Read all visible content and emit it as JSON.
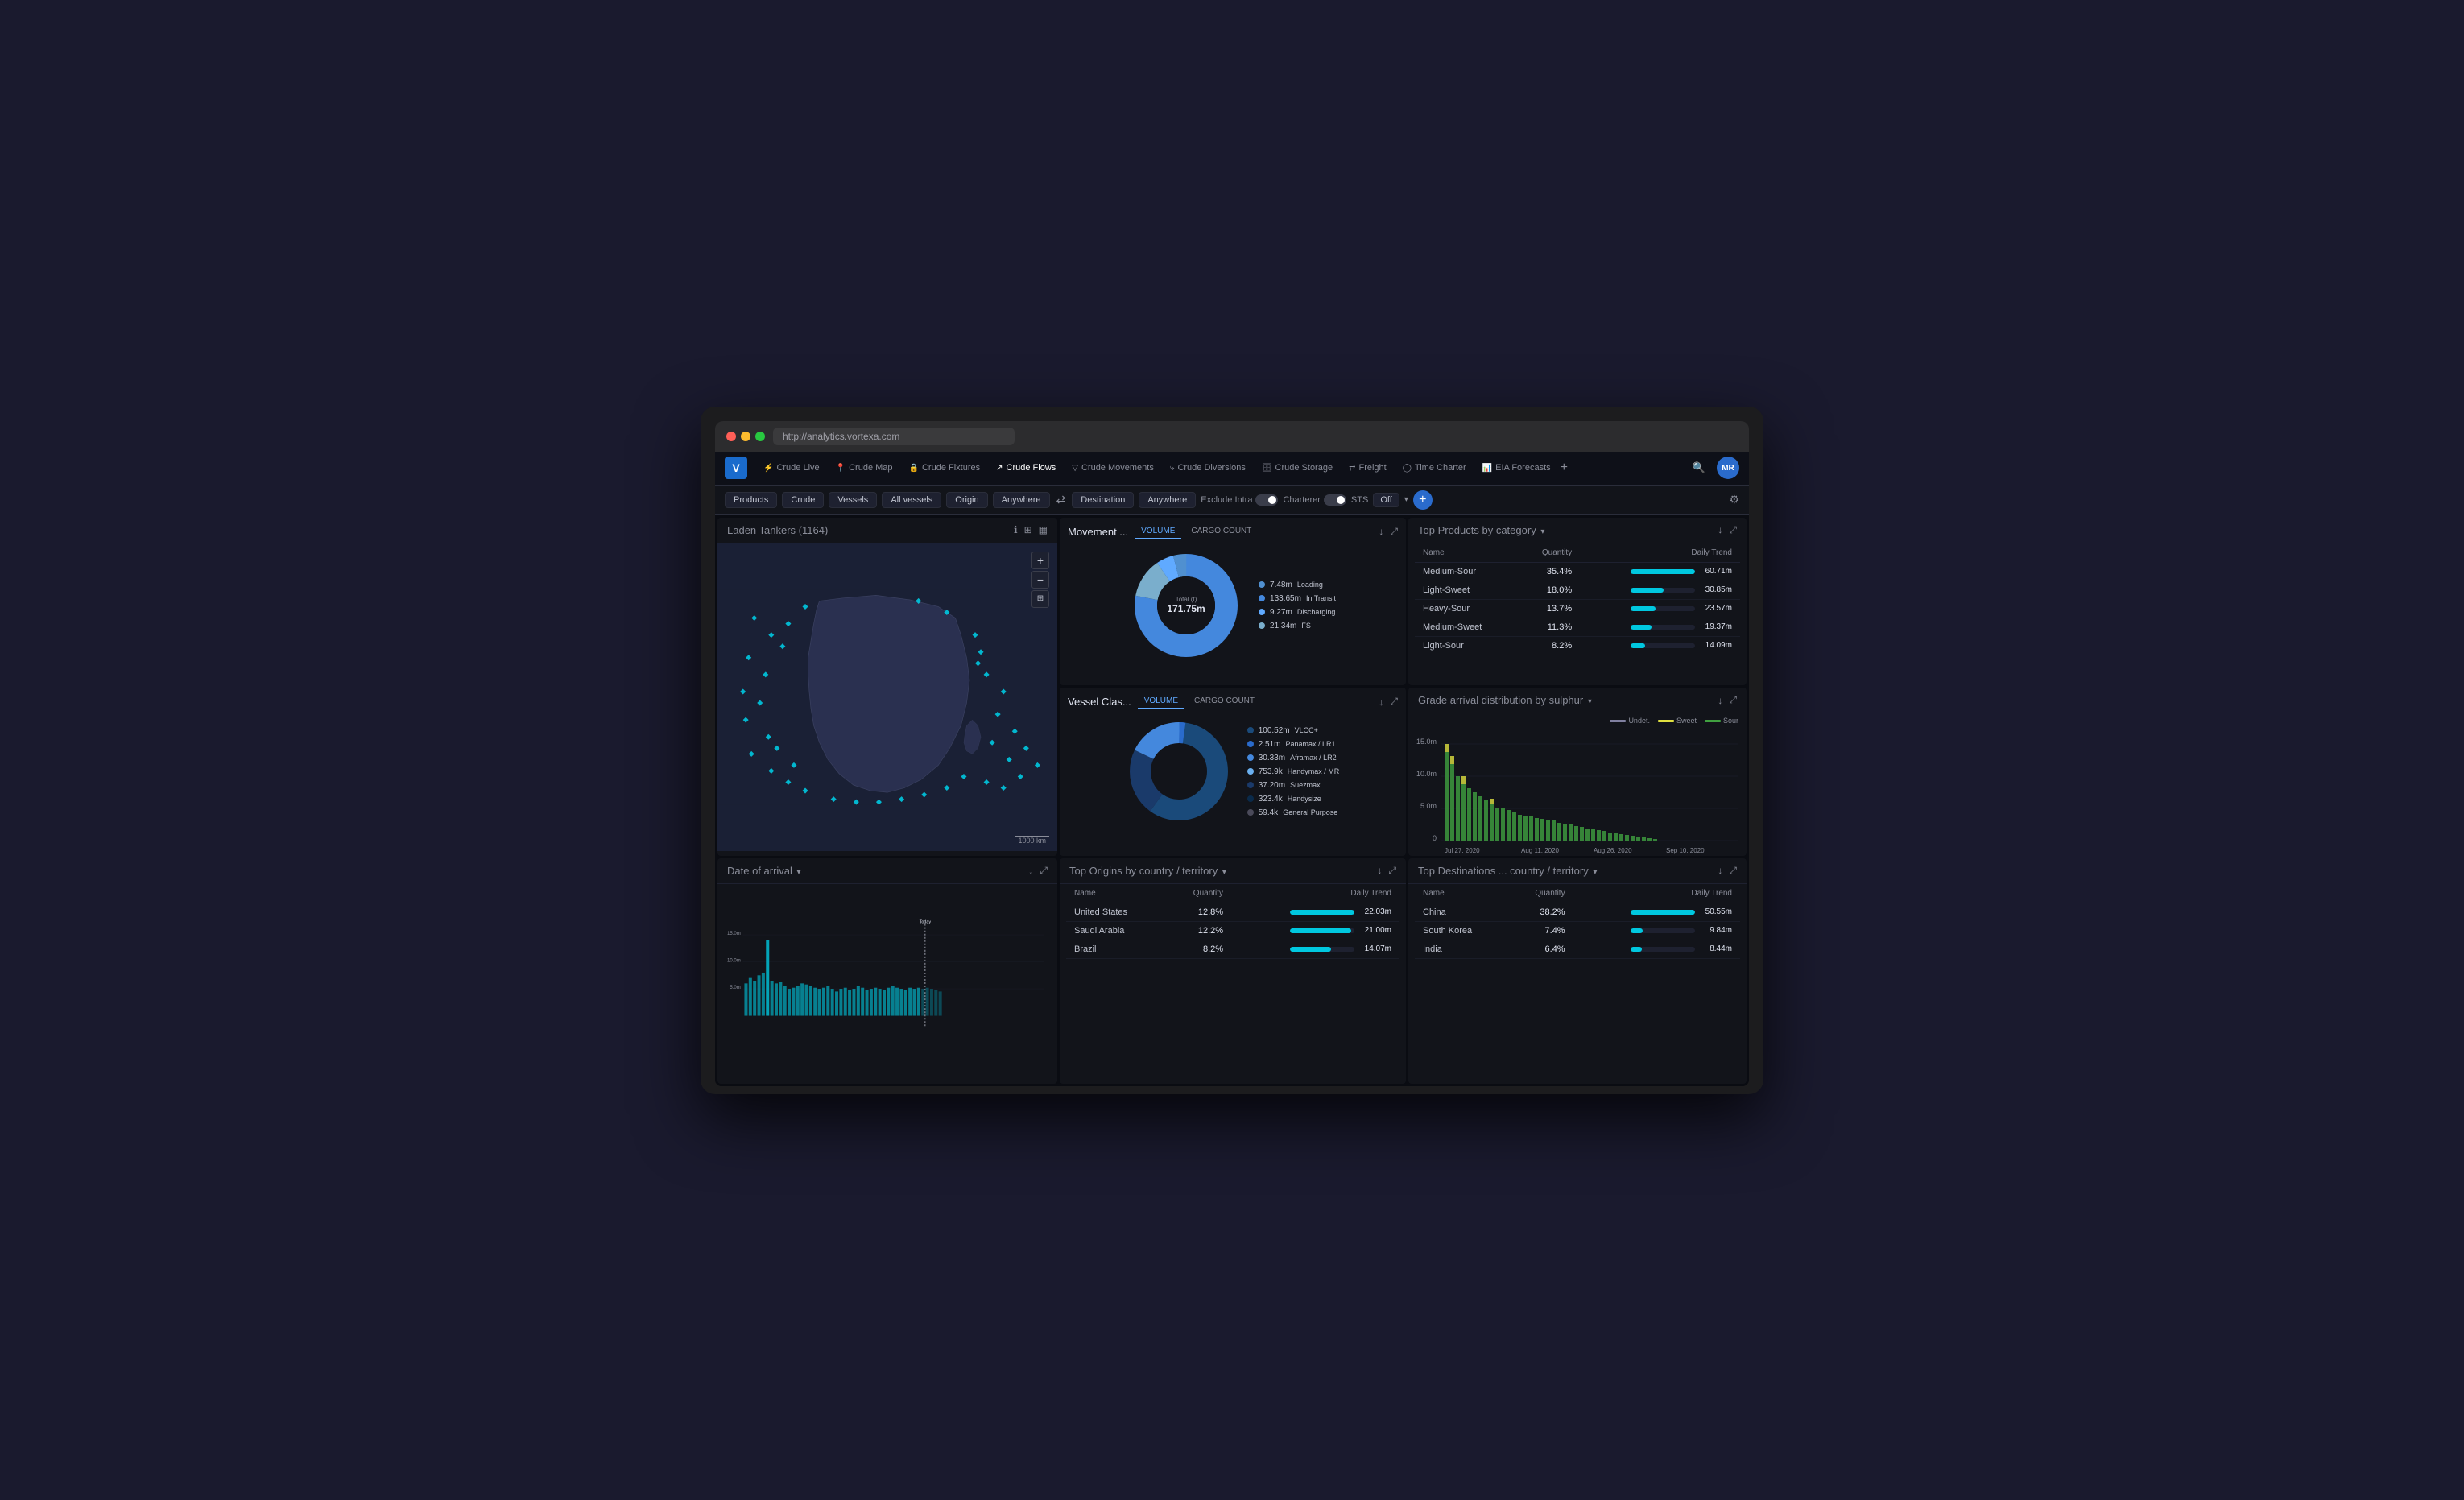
{
  "browser": {
    "url": "http://analytics.vortexa.com"
  },
  "nav": {
    "logo": "V",
    "items": [
      {
        "label": "Crude Live",
        "icon": "⚡",
        "active": false
      },
      {
        "label": "Crude Map",
        "icon": "📍",
        "active": false
      },
      {
        "label": "Crude Fixtures",
        "icon": "🔒",
        "active": false
      },
      {
        "label": "Crude Flows",
        "icon": "↗",
        "active": true
      },
      {
        "label": "Crude Movements",
        "icon": "▽",
        "active": false
      },
      {
        "label": "Crude Diversions",
        "icon": "⤷",
        "active": false
      },
      {
        "label": "Crude Storage",
        "icon": "🗄",
        "active": false
      },
      {
        "label": "Freight",
        "icon": "⇄",
        "active": false
      },
      {
        "label": "Time Charter",
        "icon": "◯",
        "active": false
      },
      {
        "label": "EIA Forecasts",
        "icon": "📊",
        "active": false
      }
    ],
    "add_icon": "+",
    "user_initials": "MR"
  },
  "filters": {
    "products": "Products",
    "crude": "Crude",
    "vessels": "Vessels",
    "all_vessels": "All vessels",
    "origin": "Origin",
    "anywhere1": "Anywhere",
    "arrows": "⇄",
    "destination": "Destination",
    "anywhere2": "Anywhere",
    "exclude_intra": "Exclude Intra",
    "charterer": "Charterer",
    "sts_label": "STS",
    "sts_value": "Off"
  },
  "map_panel": {
    "title": "Laden Tankers",
    "count": "(1164)"
  },
  "movement_panel": {
    "title": "Movement ...",
    "tab_volume": "VOLUME",
    "tab_cargo": "CARGO COUNT",
    "total_label": "Total (t)",
    "total_value": "171.75m",
    "legend": [
      {
        "label": "Loading",
        "value": "7.48m",
        "color": "#5090d0"
      },
      {
        "label": "In Transit",
        "value": "133.65m",
        "color": "#4488dd"
      },
      {
        "label": "Discharging",
        "value": "9.27m",
        "color": "#60aaff"
      },
      {
        "label": "FS",
        "value": "21.34m",
        "color": "#8ab0cc"
      }
    ]
  },
  "vessel_class_panel": {
    "title": "Vessel Clas...",
    "tab_volume": "VOLUME",
    "tab_cargo": "CARGO COUNT",
    "legend": [
      {
        "label": "VLCC+",
        "value": "100.52m",
        "color": "#1a4a7a"
      },
      {
        "label": "Panamax / LR1",
        "value": "2.51m",
        "color": "#2a6bcc"
      },
      {
        "label": "Aframax / LR2",
        "value": "30.33m",
        "color": "#4488dd"
      },
      {
        "label": "Handymax / MR",
        "value": "753.9k",
        "color": "#6ab0f0"
      },
      {
        "label": "Suezmax",
        "value": "37.20m",
        "color": "#1a3a6a"
      },
      {
        "label": "Handysize",
        "value": "323.4k",
        "color": "#0a2a4a"
      },
      {
        "label": "General Purpose",
        "value": "59.4k",
        "color": "#0e1e38"
      }
    ]
  },
  "products_panel": {
    "title": "Top Products by category",
    "dropdown_arrow": "▾",
    "col_name": "Name",
    "col_quantity": "Quantity",
    "col_trend": "Daily Trend",
    "rows": [
      {
        "name": "Medium-Sour",
        "pct": "35.4%",
        "bar": 100,
        "value": "60.71m"
      },
      {
        "name": "Light-Sweet",
        "pct": "18.0%",
        "bar": 51,
        "value": "30.85m"
      },
      {
        "name": "Heavy-Sour",
        "pct": "13.7%",
        "bar": 39,
        "value": "23.57m"
      },
      {
        "name": "Medium-Sweet",
        "pct": "11.3%",
        "bar": 32,
        "value": "19.37m"
      },
      {
        "name": "Light-Sour",
        "pct": "8.2%",
        "bar": 23,
        "value": "14.09m"
      }
    ]
  },
  "grade_panel": {
    "title": "Grade arrival distribution by sulphur",
    "dropdown_arrow": "▾",
    "legend": [
      {
        "label": "Undet.",
        "color": "#8080a0"
      },
      {
        "label": "Sweet",
        "color": "#e0e040"
      },
      {
        "label": "Sour",
        "color": "#40a040"
      }
    ],
    "x_labels": [
      "Jul 27, 2020",
      "Aug 11, 2020",
      "Aug 26, 2020",
      "Sep 10, 2020"
    ],
    "y_labels": [
      "0",
      "5.0m",
      "10.0m",
      "15.0m"
    ]
  },
  "date_panel": {
    "title": "Date of arrival",
    "dropdown_arrow": "▾",
    "today_label": "Today",
    "y_labels": [
      "5.0m",
      "10.0m",
      "15.0m"
    ]
  },
  "origins_panel": {
    "title": "Top Origins by country / territory",
    "dropdown_arrow": "▾",
    "col_name": "Name",
    "col_quantity": "Quantity",
    "col_trend": "Daily Trend",
    "rows": [
      {
        "name": "United States",
        "pct": "12.8%",
        "bar": 100,
        "value": "22.03m"
      },
      {
        "name": "Saudi Arabia",
        "pct": "12.2%",
        "bar": 95,
        "value": "21.00m"
      },
      {
        "name": "Brazil",
        "pct": "8.2%",
        "bar": 64,
        "value": "14.07m"
      }
    ]
  },
  "destinations_panel": {
    "title": "Top Destinations ... country / territory",
    "dropdown_arrow": "▾",
    "col_name": "Name",
    "col_quantity": "Quantity",
    "col_trend": "Daily Trend",
    "rows": [
      {
        "name": "China",
        "pct": "38.2%",
        "bar": 100,
        "value": "50.55m"
      },
      {
        "name": "South Korea",
        "pct": "7.4%",
        "bar": 19,
        "value": "9.84m"
      },
      {
        "name": "India",
        "pct": "6.4%",
        "bar": 17,
        "value": "8.44m"
      }
    ]
  },
  "colors": {
    "accent": "#00c8e0",
    "accent2": "#2a6bcc",
    "bg": "#12141a",
    "bg_dark": "#0a0c12",
    "text_primary": "#e0e4f0",
    "text_secondary": "#8a8d99",
    "border": "#1e2130"
  }
}
